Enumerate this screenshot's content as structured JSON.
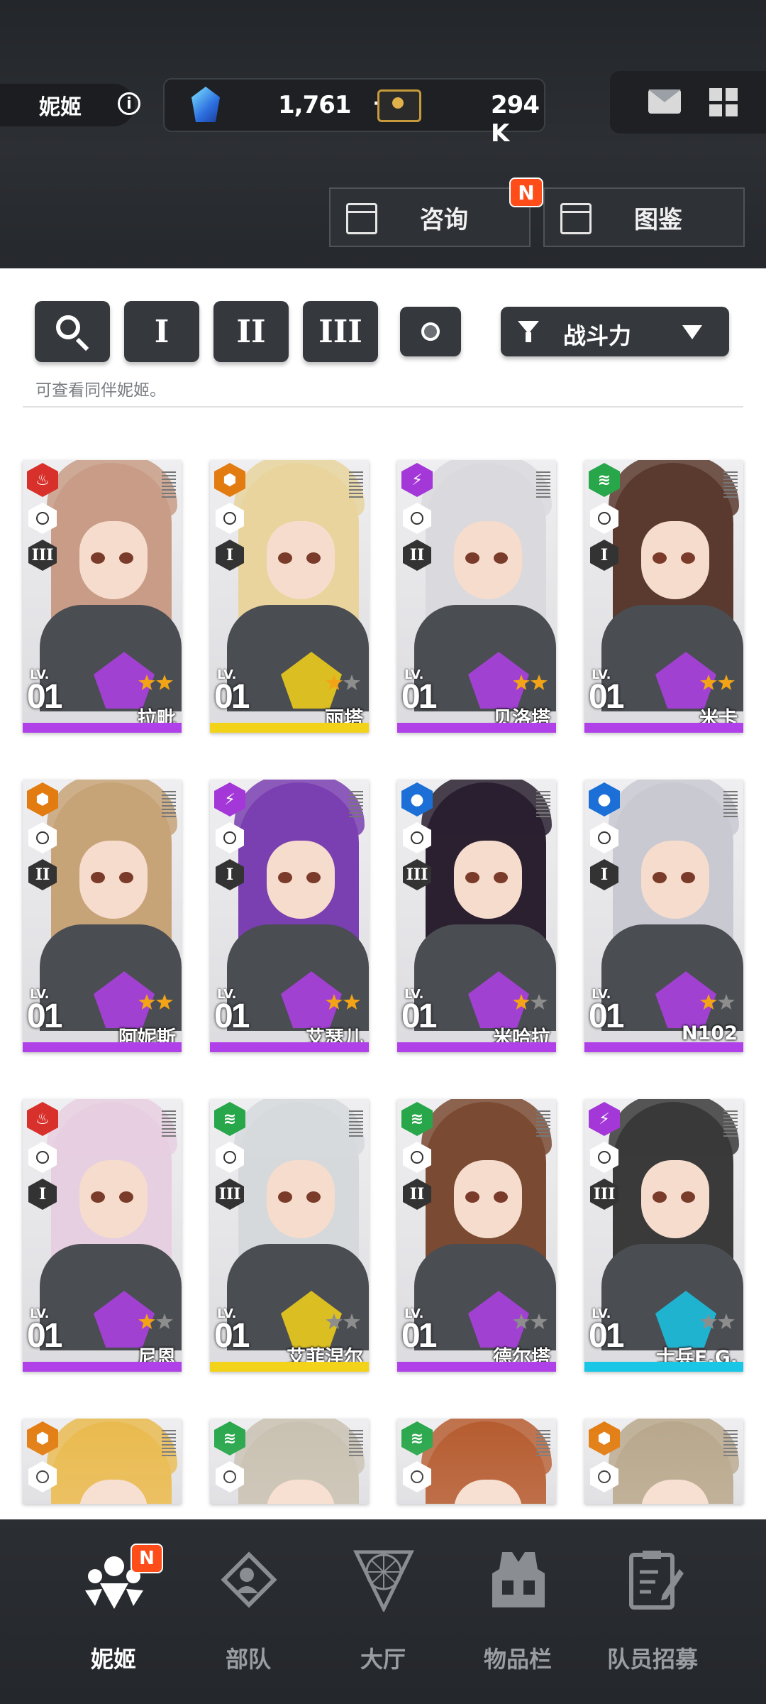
{
  "header": {
    "tab_label": "妮姬",
    "info_icon": "i",
    "gems": "1,761",
    "gems_plus": "+",
    "credits": "294 K",
    "consult_label": "咨询",
    "consult_badge": "N",
    "codex_label": "图鉴"
  },
  "filters": {
    "class_1": "I",
    "class_2": "II",
    "class_3": "III",
    "sort_label": "战斗力",
    "hint": "可查看同伴妮姬。"
  },
  "lv_label": "LV.",
  "cards": [
    {
      "name": "拉毗",
      "level": "01",
      "burst": "III",
      "element": "fire",
      "rarity": "purple",
      "stars": 2
    },
    {
      "name": "丽塔",
      "level": "01",
      "burst": "I",
      "element": "iron",
      "rarity": "yellow",
      "stars": 1
    },
    {
      "name": "贝洛塔",
      "level": "01",
      "burst": "II",
      "element": "electric",
      "rarity": "purple",
      "stars": 2
    },
    {
      "name": "米卡",
      "level": "01",
      "burst": "I",
      "element": "wind",
      "rarity": "purple",
      "stars": 2
    },
    {
      "name": "阿妮斯",
      "level": "01",
      "burst": "II",
      "element": "iron",
      "rarity": "purple",
      "stars": 2
    },
    {
      "name": "艾瑟儿",
      "level": "01",
      "burst": "I",
      "element": "electric",
      "rarity": "purple",
      "stars": 2
    },
    {
      "name": "米哈拉",
      "level": "01",
      "burst": "III",
      "element": "water",
      "rarity": "purple",
      "stars": 1
    },
    {
      "name": "N102",
      "level": "01",
      "burst": "I",
      "element": "water",
      "rarity": "purple",
      "stars": 1
    },
    {
      "name": "尼恩",
      "level": "01",
      "burst": "I",
      "element": "fire",
      "rarity": "purple",
      "stars": 1
    },
    {
      "name": "艾菲涅尔",
      "level": "01",
      "burst": "III",
      "element": "wind",
      "rarity": "yellow",
      "stars": 0
    },
    {
      "name": "德尔塔",
      "level": "01",
      "burst": "II",
      "element": "wind",
      "rarity": "purple",
      "stars": 0
    },
    {
      "name": "士兵E.G.",
      "level": "01",
      "burst": "III",
      "element": "electric",
      "rarity": "cyan",
      "stars": 0
    },
    {
      "name": "",
      "level": "",
      "burst": "",
      "element": "iron",
      "rarity": "purple",
      "stars": 0
    },
    {
      "name": "",
      "level": "",
      "burst": "",
      "element": "wind",
      "rarity": "purple",
      "stars": 0
    },
    {
      "name": "",
      "level": "",
      "burst": "",
      "element": "wind",
      "rarity": "purple",
      "stars": 0
    },
    {
      "name": "",
      "level": "",
      "burst": "",
      "element": "iron",
      "rarity": "purple",
      "stars": 0
    }
  ],
  "colors": {
    "fire": "#d8312b",
    "iron": "#e27c10",
    "electric": "#a437d8",
    "wind": "#27a64a",
    "water": "#1b6fd6",
    "purple": "#b040e8",
    "yellow": "#f3d21a",
    "cyan": "#19c6e6",
    "star_gold": "#f2a416",
    "star_grey": "#8d8d8d"
  },
  "nav": {
    "nikke": "妮姬",
    "squad": "部队",
    "lobby": "大厅",
    "inventory": "物品栏",
    "recruit": "队员招募",
    "badge": "N"
  }
}
